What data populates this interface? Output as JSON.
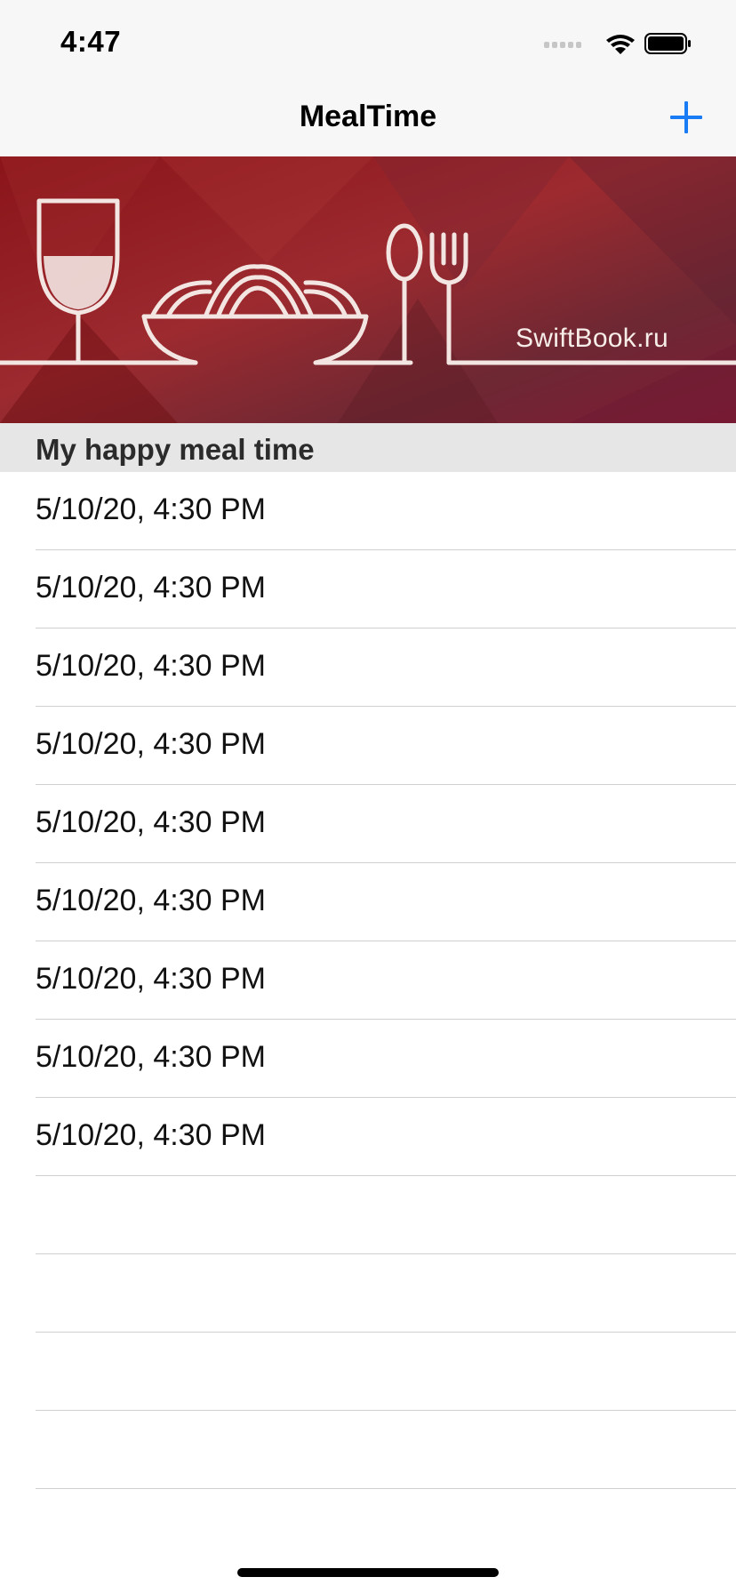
{
  "status_bar": {
    "time": "4:47"
  },
  "nav": {
    "title": "MealTime",
    "add_icon": "plus-icon",
    "accent_color": "#1a7cf5"
  },
  "banner": {
    "text": "SwiftBook.ru",
    "colors": [
      "#7d1016",
      "#a3282c",
      "#6b2634",
      "#8c1f3a"
    ]
  },
  "section": {
    "title": "My happy meal time"
  },
  "rows": [
    {
      "label": "5/10/20, 4:30 PM"
    },
    {
      "label": "5/10/20, 4:30 PM"
    },
    {
      "label": "5/10/20, 4:30 PM"
    },
    {
      "label": "5/10/20, 4:30 PM"
    },
    {
      "label": "5/10/20, 4:30 PM"
    },
    {
      "label": "5/10/20, 4:30 PM"
    },
    {
      "label": "5/10/20, 4:30 PM"
    },
    {
      "label": "5/10/20, 4:30 PM"
    },
    {
      "label": "5/10/20, 4:30 PM"
    },
    {
      "label": ""
    },
    {
      "label": ""
    },
    {
      "label": ""
    },
    {
      "label": ""
    }
  ]
}
